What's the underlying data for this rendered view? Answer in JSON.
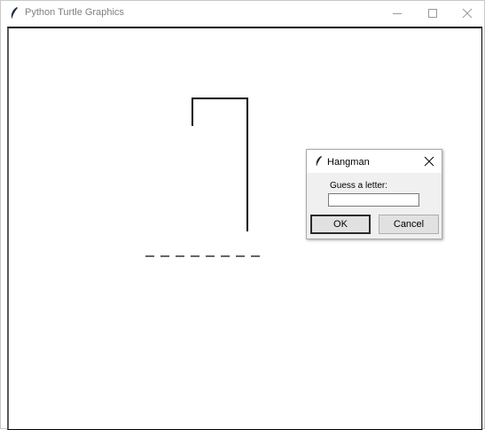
{
  "window": {
    "title": "Python Turtle Graphics",
    "controls": {
      "minimize": "minimize-icon",
      "maximize": "maximize-icon",
      "close": "close-icon"
    }
  },
  "canvas": {
    "letter_blanks": 8,
    "colors": {
      "line": "#000000",
      "background": "#ffffff"
    }
  },
  "dialog": {
    "title": "Hangman",
    "prompt": "Guess a letter:",
    "input_value": "",
    "ok_label": "OK",
    "cancel_label": "Cancel"
  },
  "colors": {
    "dialog_bg": "#f0f0f0",
    "button_bg": "#e1e1e1",
    "title_text": "#808080"
  }
}
